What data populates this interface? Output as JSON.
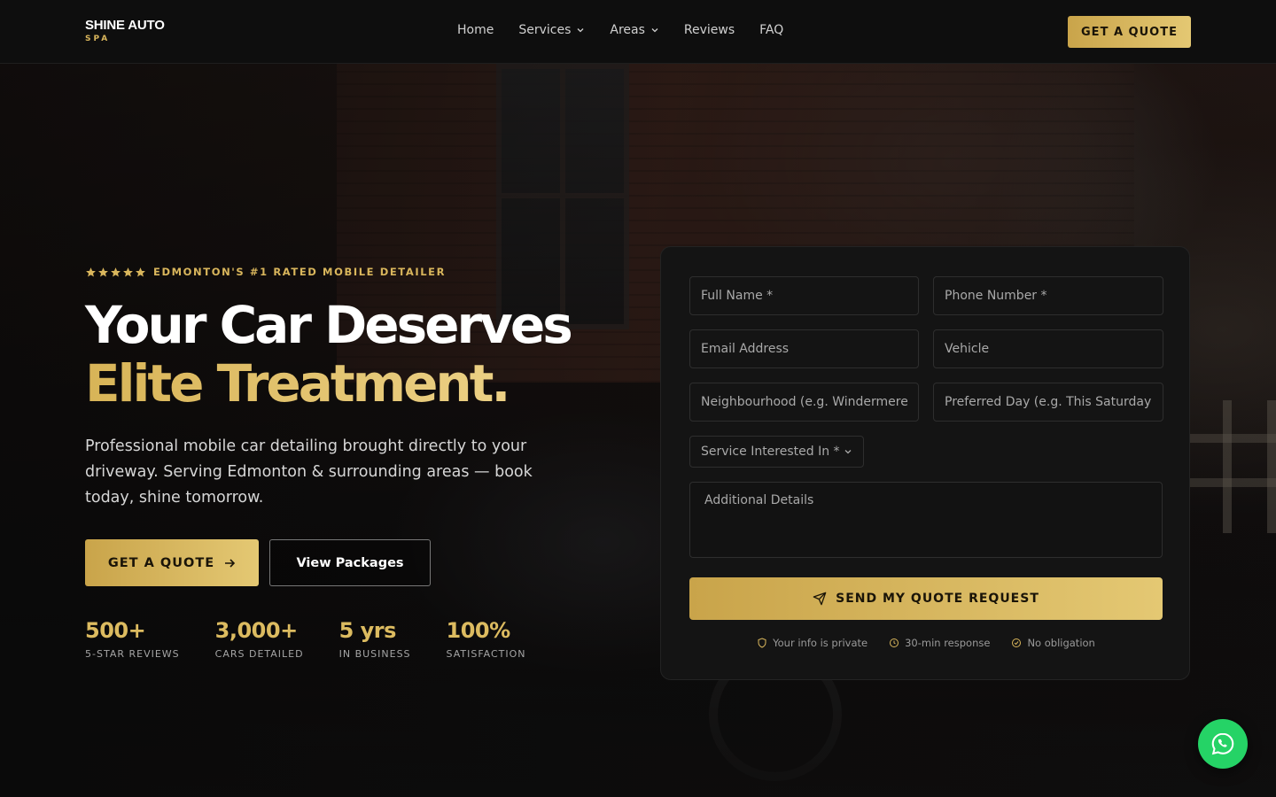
{
  "brand": {
    "name": "SHINE AUTO",
    "tagline": "SPA",
    "accent": "#d9b65c"
  },
  "nav": {
    "items": [
      {
        "label": "Home",
        "dropdown": false
      },
      {
        "label": "Services",
        "dropdown": true
      },
      {
        "label": "Areas",
        "dropdown": true
      },
      {
        "label": "Reviews",
        "dropdown": false
      },
      {
        "label": "FAQ",
        "dropdown": false
      }
    ],
    "cta_label": "GET A QUOTE"
  },
  "hero": {
    "rating_stars": 5,
    "eyebrow": "EDMONTON'S #1 RATED MOBILE DETAILER",
    "headline_line1": "Your Car Deserves",
    "headline_line2": "Elite Treatment.",
    "lede": "Professional mobile car detailing brought directly to your driveway. Serving Edmonton & surrounding areas — book today, shine tomorrow.",
    "primary_cta": "GET A QUOTE",
    "secondary_cta": "View Packages",
    "stats": [
      {
        "value": "500+",
        "label": "5-STAR REVIEWS"
      },
      {
        "value": "3,000+",
        "label": "CARS DETAILED"
      },
      {
        "value": "5 yrs",
        "label": "IN BUSINESS"
      },
      {
        "value": "100%",
        "label": "SATISFACTION"
      }
    ]
  },
  "form": {
    "full_name_placeholder": "Full Name *",
    "phone_placeholder": "Phone Number *",
    "email_placeholder": "Email Address",
    "vehicle_placeholder": "Vehicle",
    "neighbourhood_placeholder": "Neighbourhood (e.g. Windermere)",
    "preferred_day_placeholder": "Preferred Day (e.g. This Saturday)",
    "service_select_label": "Service Interested In *",
    "details_placeholder": "Additional Details",
    "submit_label": "SEND MY QUOTE REQUEST",
    "assurances": [
      {
        "icon": "shield-icon",
        "label": "Your info is private"
      },
      {
        "icon": "clock-icon",
        "label": "30-min response"
      },
      {
        "icon": "check-circle-icon",
        "label": "No obligation"
      }
    ]
  },
  "whatsapp": {
    "icon": "whatsapp-icon",
    "color": "#25d366"
  }
}
